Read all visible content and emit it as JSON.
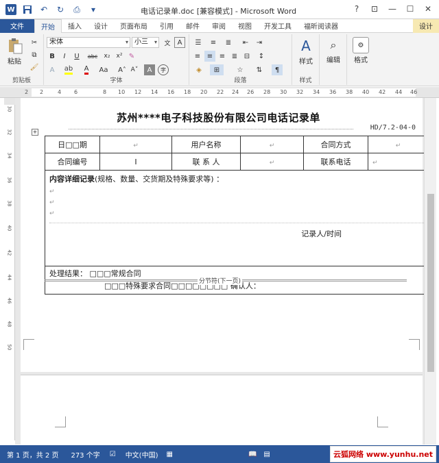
{
  "window": {
    "title": "电话记录单.doc [兼容模式] - Microsoft Word",
    "buttons": {
      "help": "?",
      "restore_ribbon": "⊡",
      "minimize": "—",
      "maximize": "☐",
      "close": "✕"
    }
  },
  "qat": {
    "word_icon": "W",
    "save": "💾",
    "undo": "↶",
    "redo": "↻",
    "preview": "🔍"
  },
  "tabs": [
    {
      "label": "文件"
    },
    {
      "label": "开始"
    },
    {
      "label": "插入"
    },
    {
      "label": "设计"
    },
    {
      "label": "页面布局"
    },
    {
      "label": "引用"
    },
    {
      "label": "邮件"
    },
    {
      "label": "审阅"
    },
    {
      "label": "视图"
    },
    {
      "label": "开发工具"
    },
    {
      "label": "福昕阅读器"
    },
    {
      "label": "设计"
    }
  ],
  "ribbon": {
    "clipboard": {
      "label": "剪贴板",
      "paste": "粘贴"
    },
    "font": {
      "label": "字体",
      "font_name": "宋体",
      "font_size": "小三"
    },
    "paragraph": {
      "label": "段落"
    },
    "styles": {
      "label": "样式",
      "button": "样式"
    },
    "editing": {
      "button": "编辑"
    },
    "foxit": {
      "button": "格式"
    }
  },
  "ruler": {
    "ticks": [
      "2",
      "2",
      "4",
      "6",
      "8",
      "10",
      "12",
      "14",
      "16",
      "18",
      "20",
      "22",
      "24",
      "26",
      "28",
      "30",
      "32",
      "34",
      "36",
      "38",
      "40",
      "42",
      "44",
      "46"
    ]
  },
  "vruler": {
    "ticks": [
      "30",
      "32",
      "34",
      "36",
      "38",
      "40",
      "42",
      "44",
      "46",
      "48",
      "50"
    ]
  },
  "document": {
    "title": "苏州****电子科技股份有限公司电话记录单",
    "code": "HD/7.2-04-0",
    "rows": {
      "date_label": "日□□期",
      "user_label": "用户名称",
      "contract_method_label": "合同方式",
      "contract_no_label": "合同编号",
      "contact_label": "联 系 人",
      "phone_label": "联系电话",
      "detail_label": "内容详细记录",
      "detail_hint": "(规格、数量、交货期及特殊要求等) ：",
      "recorder": "记录人/时间",
      "result_label": "处理结果：",
      "regular": "□□□常规合同",
      "special": "□□□特殊要求合同□□□□□□□□",
      "confirm": "确认人："
    },
    "section_break": "分节符(下一页)"
  },
  "status": {
    "page": "第 1 页，共 2 页",
    "words": "273 个字",
    "language": "中文(中国)"
  },
  "watermark": "云狐网络 www.yunhu.net"
}
